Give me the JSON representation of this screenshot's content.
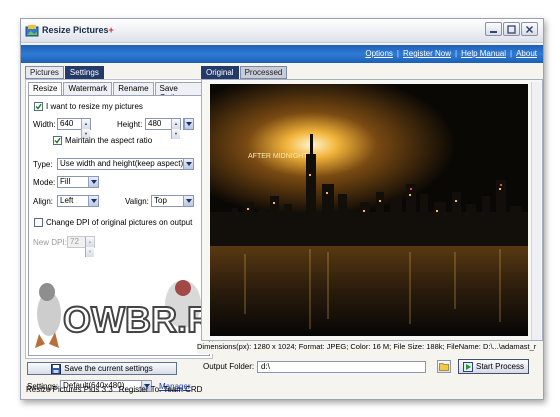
{
  "window": {
    "title": "Resize Pictures",
    "title_suffix": "+",
    "accent_color": "#1f5fb4"
  },
  "menu": {
    "items": [
      "Options",
      "Register Now",
      "Help Manual",
      "About"
    ]
  },
  "left": {
    "top_tabs": [
      "Pictures",
      "Settings"
    ],
    "active_top_tab": "Settings",
    "sub_tabs": [
      "Resize",
      "Watermark",
      "Rename",
      "Save Options"
    ],
    "active_sub_tab": "Resize",
    "resize_checkbox_label": "I want to resize my pictures",
    "width_label": "Width:",
    "width_value": "640",
    "height_label": "Height:",
    "height_value": "480",
    "aspect_label": "Maintain the aspect ratio",
    "type_label": "Type:",
    "type_value": "Use width and height(keep aspect)",
    "mode_label": "Mode:",
    "mode_value": "Fill",
    "align_label": "Align:",
    "align_value": "Left",
    "valign_label": "Valign:",
    "valign_value": "Top",
    "dpi_checkbox_label": "Change DPI of original pictures on output",
    "new_dpi_label": "New DPI:",
    "new_dpi_value": "72",
    "watermark_text": "OWBR.RU",
    "save_button_label": "Save the current settings",
    "settings_label": "Settings:",
    "settings_value": "Default(640x480)",
    "manager_label": "Manager"
  },
  "right": {
    "tabs": [
      "Original",
      "Processed"
    ],
    "active_tab": "Original",
    "image_caption": "AFTER MIDNIGHT",
    "info_line": "Dimensions(px): 1280 x 1024;  Format: JPEG;  Color: 16 M;  File Size: 188k;  FileName: D:\\...\\adamast_r",
    "output_label": "Output Folder:",
    "output_value": "d:\\",
    "start_button_label": "Start Process"
  },
  "status": {
    "version": "Resize Pictures Plus 3.3",
    "register": "Register To: Team CRD"
  }
}
